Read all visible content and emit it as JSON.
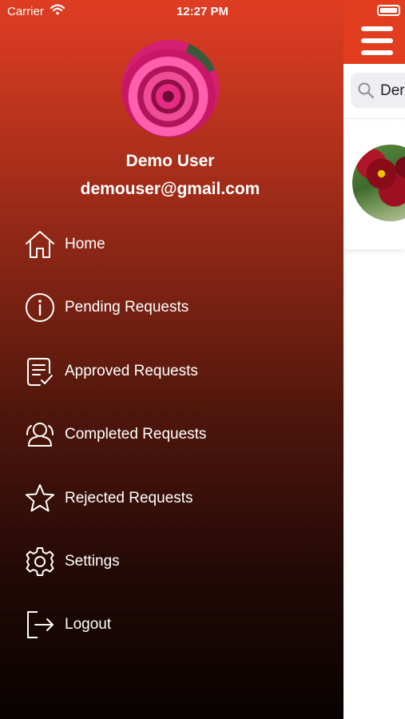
{
  "status_bar": {
    "carrier": "Carrier",
    "time": "12:27 PM"
  },
  "profile": {
    "name": "Demo User",
    "email": "demouser@gmail.com"
  },
  "menu": {
    "items": [
      {
        "label": "Home",
        "icon": "home-icon"
      },
      {
        "label": "Pending Requests",
        "icon": "info-icon"
      },
      {
        "label": "Approved Requests",
        "icon": "document-check-icon"
      },
      {
        "label": "Completed Requests",
        "icon": "users-icon"
      },
      {
        "label": "Rejected Requests",
        "icon": "star-icon"
      },
      {
        "label": "Settings",
        "icon": "gear-icon"
      },
      {
        "label": "Logout",
        "icon": "logout-icon"
      }
    ]
  },
  "main": {
    "search_text": "Der"
  },
  "colors": {
    "accent": "#e23d1f",
    "drawer_top": "#df3d22",
    "drawer_bottom": "#070201"
  }
}
